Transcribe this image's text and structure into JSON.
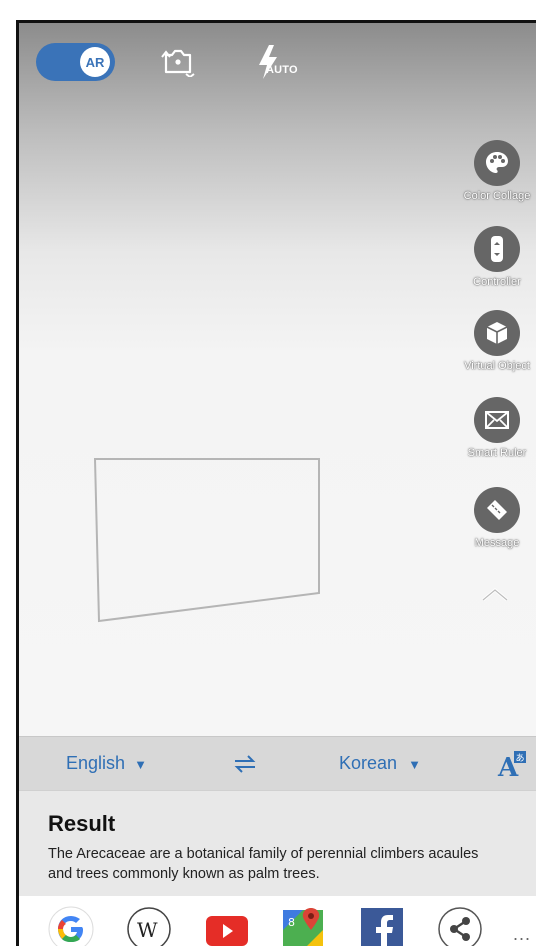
{
  "camera": {
    "ar_label": "AR",
    "flash_mode": "AUTO"
  },
  "tools": [
    {
      "label": "Color Collage",
      "icon": "palette-icon"
    },
    {
      "label": "Controller",
      "icon": "controller-icon"
    },
    {
      "label": "Virtual Object",
      "icon": "cube-icon"
    },
    {
      "label": "Smart Ruler",
      "icon": "envelope-icon"
    },
    {
      "label": "Message",
      "icon": "ruler-icon"
    }
  ],
  "translate": {
    "source_language": "English",
    "target_language": "Korean"
  },
  "result": {
    "title": "Result",
    "text": "The Arecaceae are a botanical family of perennial climbers acaules and trees commonly known as palm trees."
  },
  "apps": {
    "more_label": "..."
  },
  "colors": {
    "accent": "#3a73b8",
    "link": "#2f6fb5",
    "tool_bg": "#666666"
  }
}
